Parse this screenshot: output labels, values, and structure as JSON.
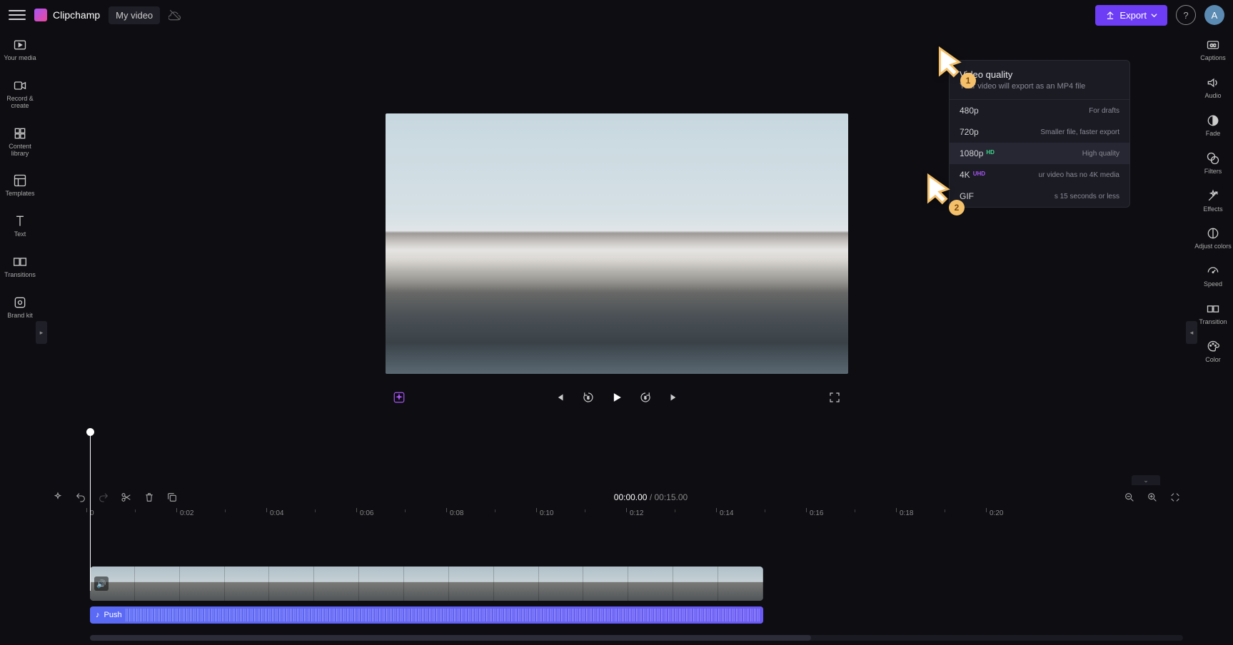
{
  "header": {
    "app_name": "Clipchamp",
    "video_title": "My video",
    "export_label": "Export",
    "avatar_initial": "A"
  },
  "left_rail": {
    "items": [
      {
        "label": "Your media"
      },
      {
        "label": "Record & create"
      },
      {
        "label": "Content library"
      },
      {
        "label": "Templates"
      },
      {
        "label": "Text"
      },
      {
        "label": "Transitions"
      },
      {
        "label": "Brand kit"
      }
    ]
  },
  "right_rail": {
    "items": [
      {
        "label": "Captions"
      },
      {
        "label": "Audio"
      },
      {
        "label": "Fade"
      },
      {
        "label": "Filters"
      },
      {
        "label": "Effects"
      },
      {
        "label": "Adjust colors"
      },
      {
        "label": "Speed"
      },
      {
        "label": "Transition"
      },
      {
        "label": "Color"
      }
    ]
  },
  "export_menu": {
    "title": "Video quality",
    "subtitle": "Your video will export as an MP4 file",
    "options": [
      {
        "res": "480p",
        "desc": "For drafts"
      },
      {
        "res": "720p",
        "desc": "Smaller file, faster export"
      },
      {
        "res": "1080p",
        "badge": "HD",
        "desc": "High quality"
      },
      {
        "res": "4K",
        "badge": "UHD",
        "desc": "ur video has no 4K media"
      },
      {
        "res": "GIF",
        "desc": "s 15 seconds or less"
      }
    ]
  },
  "cursors": {
    "one": "1",
    "two": "2"
  },
  "timeline": {
    "current": "00:00.00",
    "sep": " / ",
    "duration": "00:15.00",
    "ticks": [
      "0",
      "0:02",
      "0:04",
      "0:06",
      "0:08",
      "0:10",
      "0:12",
      "0:14",
      "0:16",
      "0:18",
      "0:20"
    ],
    "audio_clip_name": "Push"
  }
}
